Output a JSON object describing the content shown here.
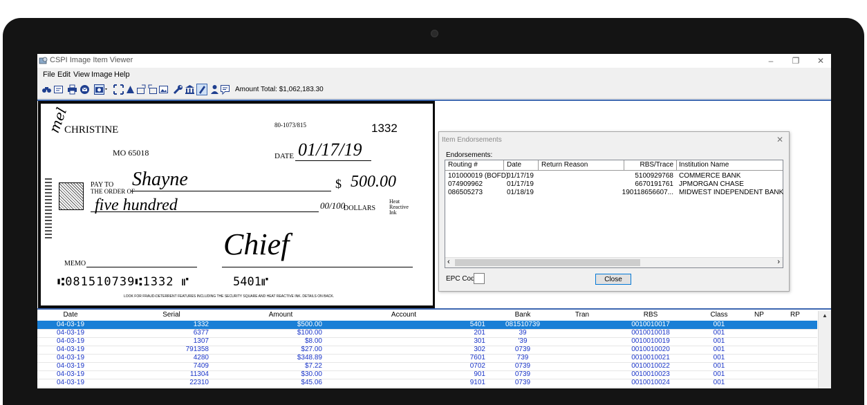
{
  "window": {
    "title": "CSPI Image Item Viewer",
    "minimize": "–",
    "restore": "❐",
    "close": "✕"
  },
  "menu": [
    "File",
    "Edit",
    "View",
    "Image",
    "Help"
  ],
  "toolbar": {
    "icons": [
      "binoculars-icon",
      "form-icon",
      "print-icon",
      "mail-icon",
      "camera-icon",
      "fit-icon",
      "rotate-icon",
      "front-icon",
      "back-icon",
      "picture-icon",
      "wrench-icon",
      "bank-icon",
      "pencil-icon",
      "person-icon",
      "comment-icon"
    ],
    "amount_total": "Amount Total: $1,062,183.30"
  },
  "check": {
    "initials": "mel",
    "name": "CHRISTINE",
    "address": "MO 65018",
    "fraction_code": "80-1073/815",
    "check_number": "1332",
    "date_label": "DATE",
    "date_value": "01/17/19",
    "payto_label_1": "PAY TO",
    "payto_label_2": "THE ORDER OF",
    "payee": "Shayne",
    "dollar_sign": "$",
    "amount": "500.00",
    "written_amount": "five hundred",
    "fraction": "00/100",
    "dollars_label": "DOLLARS",
    "heat_note": "Heat Reactive Ink",
    "memo_label": "MEMO",
    "signature": "Chief",
    "micr": "⑆081510739⑆1332 ⑈",
    "micr_account": "5401⑈",
    "footer_text": "LOOK FOR FRAUD-DETERRENT FEATURES INCLUDING THE SECURITY SQUARE AND HEAT REACTIVE INK. DETAILS ON BACK."
  },
  "dialog": {
    "title": "Item Endorsements",
    "close_icon": "✕",
    "section_label": "Endorsements:",
    "columns": [
      "Routing #",
      "Date",
      "Return Reason",
      "RBS/Trace",
      "Institution Name"
    ],
    "rows": [
      [
        "101000019 (BOFD)",
        "01/17/19",
        "",
        "5100929768",
        "COMMERCE BANK"
      ],
      [
        "074909962",
        "01/17/19",
        "",
        "6670191761",
        "JPMORGAN CHASE"
      ],
      [
        "086505273",
        "01/18/19",
        "",
        "190118656607...",
        "MIDWEST INDEPENDENT BANK"
      ]
    ],
    "scroll_left": "‹",
    "scroll_right": "›",
    "epc_label": "EPC Code:",
    "close_button": "Close"
  },
  "grid": {
    "columns": [
      "Date",
      "Serial",
      "Amount",
      "Account",
      "Bank",
      "Tran",
      "RBS",
      "Class",
      "NP",
      "RP"
    ],
    "rows": [
      [
        "04-03-19",
        "1332",
        "$500.00",
        "5401",
        "081510739",
        "",
        "0010010017",
        "001",
        "",
        ""
      ],
      [
        "04-03-19",
        "6377",
        "$100.00",
        "201",
        "39",
        "",
        "0010010018",
        "001",
        "",
        ""
      ],
      [
        "04-03-19",
        "1307",
        "$8.00",
        "301",
        "'39",
        "",
        "0010010019",
        "001",
        "",
        ""
      ],
      [
        "04-03-19",
        "791358",
        "$27.00",
        "302",
        "0739",
        "",
        "0010010020",
        "001",
        "",
        ""
      ],
      [
        "04-03-19",
        "4280",
        "$348.89",
        "7601",
        "739",
        "",
        "0010010021",
        "001",
        "",
        ""
      ],
      [
        "04-03-19",
        "7409",
        "$7.22",
        "0702",
        "0739",
        "",
        "0010010022",
        "001",
        "",
        ""
      ],
      [
        "04-03-19",
        "11304",
        "$30.00",
        "901",
        "0739",
        "",
        "0010010023",
        "001",
        "",
        ""
      ],
      [
        "04-03-19",
        "22310",
        "$45.06",
        "9101",
        "0739",
        "",
        "0010010024",
        "001",
        "",
        ""
      ]
    ],
    "scroll_up": "▲"
  }
}
